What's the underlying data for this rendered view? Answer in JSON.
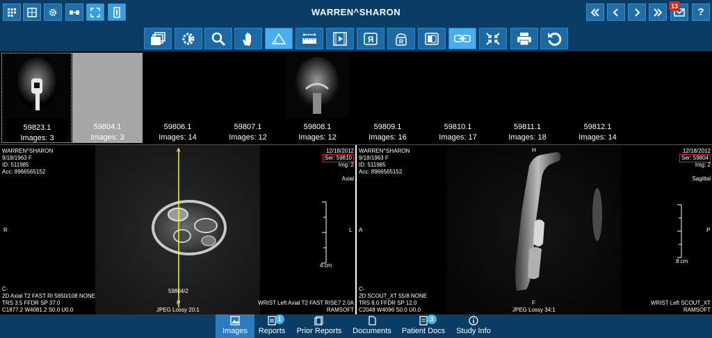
{
  "header": {
    "patient_name": "WARREN^SHARON",
    "notification_count": "13",
    "help_label": "?"
  },
  "left_icons": [
    {
      "name": "layout-grid-icon"
    },
    {
      "name": "series-layout-icon"
    },
    {
      "name": "settings-gear-icon"
    },
    {
      "name": "link-series-icon"
    },
    {
      "name": "fullscreen-icon"
    },
    {
      "name": "info-panel-icon"
    }
  ],
  "tools": [
    {
      "name": "stack-tool"
    },
    {
      "name": "window-level-tool"
    },
    {
      "name": "zoom-tool"
    },
    {
      "name": "pan-tool"
    },
    {
      "name": "angle-measure-tool"
    },
    {
      "name": "ruler-tool"
    },
    {
      "name": "cine-tool"
    },
    {
      "name": "flip-tool",
      "label": "R"
    },
    {
      "name": "rotate-tool",
      "label": "R"
    },
    {
      "name": "invert-tool"
    },
    {
      "name": "sync-tool"
    },
    {
      "name": "fit-tool"
    },
    {
      "name": "print-tool"
    },
    {
      "name": "reset-tool"
    }
  ],
  "series": [
    {
      "id": "59823.1",
      "images": "Images: 3"
    },
    {
      "id": "59804.1",
      "images": "Images: 3"
    },
    {
      "id": "59806.1",
      "images": "Images: 14"
    },
    {
      "id": "59807.1",
      "images": "Images: 12"
    },
    {
      "id": "59808.1",
      "images": "Images: 12"
    },
    {
      "id": "59809.1",
      "images": "Images: 16"
    },
    {
      "id": "59810.1",
      "images": "Images: 17"
    },
    {
      "id": "59811.1",
      "images": "Images: 18"
    },
    {
      "id": "59812.1",
      "images": "Images: 14"
    }
  ],
  "viewports": [
    {
      "patient": "WARREN^SHARON",
      "dob": "9/18/1963 F",
      "id": "ID: 511985",
      "acc": "Acc: 8966565152",
      "date": "12/18/2012",
      "ser": "Ser: 59810",
      "img": "Img: 2",
      "plane": "Axial",
      "top_label": "A",
      "bottom_label": "P",
      "left_label": "R",
      "right_label": "L",
      "scale_label": "4 cm",
      "ref_line": "59804/2",
      "bl1": "C-",
      "bl2": "2D Axial T2 FAST RI 5850/108 NONE",
      "bl3": "TRS 3.5 FFDR SP 37.0",
      "bl4": "C1877.2 W4081.2 S0.0 U0.0",
      "compression": "JPEG Lossy 20:1",
      "br1": "WRIST Left Axial T2 FAST RISE7 2.0A",
      "br2": "RAMSOFT"
    },
    {
      "patient": "WARREN^SHARON",
      "dob": "9/18/1963 F",
      "id": "ID: 511985",
      "acc": "Acc: 8966565152",
      "date": "12/18/2012",
      "ser": "Ser: 59804",
      "img": "Img: 2",
      "plane": "Sagittal",
      "top_label": "H",
      "bottom_label": "F",
      "left_label": "A",
      "right_label": "P",
      "scale_label": "8 cm",
      "bl1": "C-",
      "bl2": "2D SCOUT_XT 55/8 NONE",
      "bl3": "TRS 8.0 FFDR SP 12.0",
      "bl4": "C2048 W4096 S0.0 U0.0",
      "compression": "JPEG Lossy 34:1",
      "br1": "WRIST Left SCOUT_XT",
      "br2": "RAMSOFT"
    }
  ],
  "bottom_tabs": [
    {
      "label": "Images",
      "badge": ""
    },
    {
      "label": "Reports",
      "badge": "1"
    },
    {
      "label": "Prior Reports",
      "badge": ""
    },
    {
      "label": "Documents",
      "badge": ""
    },
    {
      "label": "Patient Docs",
      "badge": "3"
    },
    {
      "label": "Study Info",
      "badge": ""
    }
  ],
  "colors": {
    "accent": "#2a7bbf",
    "reference_line": "#ffff00",
    "series_box": "#e0201c"
  }
}
